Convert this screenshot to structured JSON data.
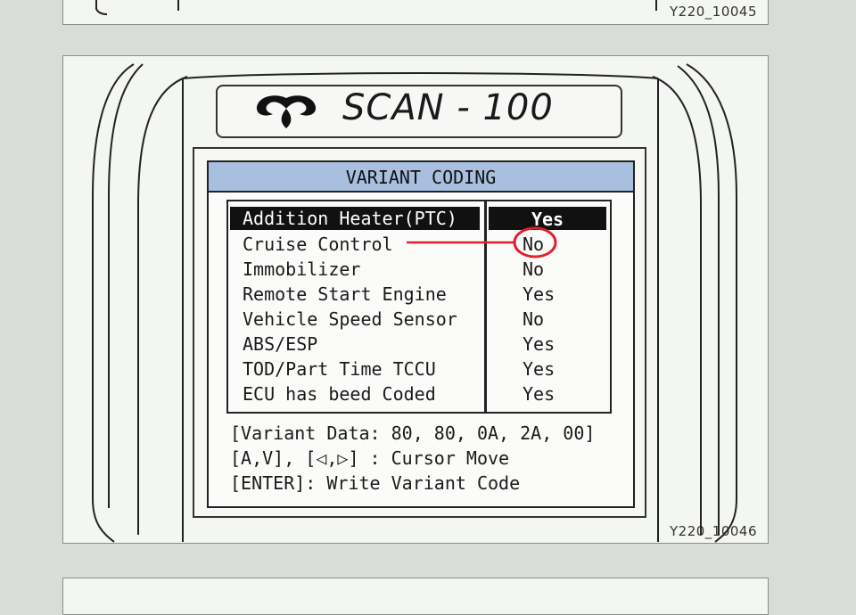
{
  "figures": {
    "top_label": "Y220_10045",
    "main_label": "Y220_10046"
  },
  "device": {
    "brand_title": "SCAN - 100",
    "logo_icon": "ssangyong-wing-logo-icon"
  },
  "screen": {
    "header": "VARIANT CODING",
    "rows": [
      {
        "name": "Addition Heater(PTC)",
        "value": "Yes",
        "selected": true
      },
      {
        "name": "Cruise Control",
        "value": "No",
        "highlighted": true
      },
      {
        "name": "Immobilizer",
        "value": "No"
      },
      {
        "name": "Remote Start Engine",
        "value": "Yes"
      },
      {
        "name": "Vehicle Speed Sensor",
        "value": "No"
      },
      {
        "name": "ABS/ESP",
        "value": "Yes"
      },
      {
        "name": "TOD/Part Time TCCU",
        "value": "Yes"
      },
      {
        "name": "ECU has beed Coded",
        "value": "Yes"
      }
    ],
    "footer": {
      "variant_data": "[Variant Data: 80, 80, 0A, 2A, 00]",
      "cursor_help": "[A,V], [◁,▷] : Cursor Move",
      "enter_help": "[ENTER]: Write Variant Code"
    }
  },
  "colors": {
    "header_bg": "#a9bfe0",
    "annotation": "#e0202a"
  }
}
